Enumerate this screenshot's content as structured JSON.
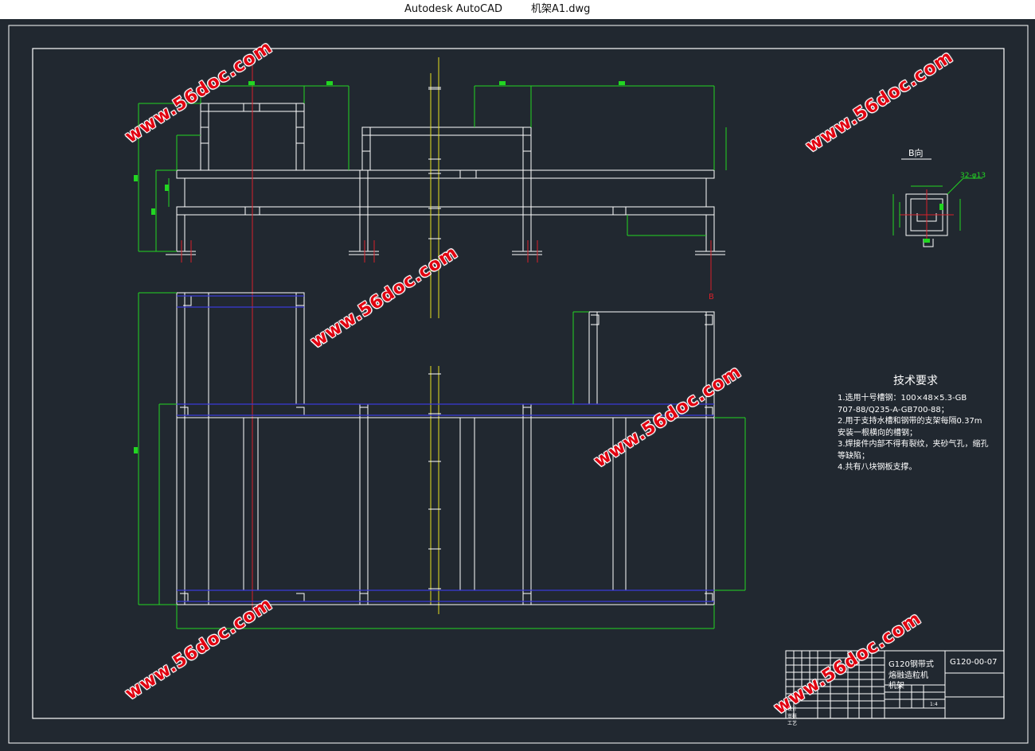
{
  "window": {
    "app_name": "Autodesk AutoCAD",
    "file_name": "机架A1.dwg"
  },
  "watermark": {
    "text": "www.56doc.com",
    "color": "#e10010"
  },
  "drawing": {
    "view_label": "B向",
    "callout_b": "B",
    "hole_note": "32-φ13",
    "colors": {
      "background": "#212830",
      "lines": "#ffffff",
      "dimensions": "#22d622",
      "centerline_red": "#d8202a",
      "centerline_yellow": "#e8e020",
      "hidden_blue": "#3a3ad8"
    }
  },
  "tech_requirements": {
    "title": "技术要求",
    "items": [
      "1.选用十号槽钢：100×48×5.3-GB",
      "707-88/Q235-A-GB700-88；",
      "2.用于支持水槽和钢带的支架每隔0.37m",
      "安装一根横向的槽钢；",
      "3.焊接件内部不得有裂纹，夹砂气孔，缩孔",
      "等缺陷；",
      "4.共有八块钢板支撑。"
    ]
  },
  "title_block": {
    "product_name_1": "G120钢带式",
    "product_name_2": "熔融造粒机",
    "part_name": "机架",
    "drawing_number": "G120-00-07",
    "scale": "1:4",
    "design_label": "设计",
    "approve_label": "审核",
    "process_label": "工艺"
  }
}
